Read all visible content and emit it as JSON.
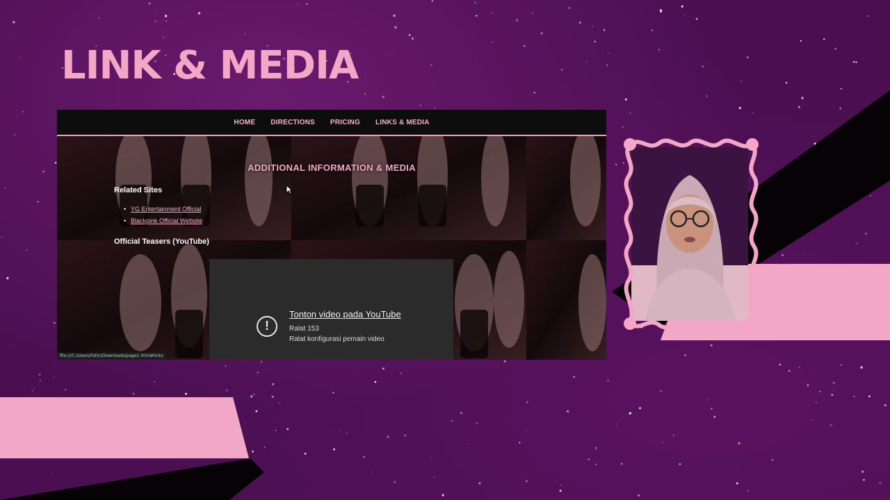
{
  "slide": {
    "title": "LINK & MEDIA",
    "colors": {
      "pink": "#f4a6c6",
      "purple": "#4a0f50",
      "black": "#050205"
    }
  },
  "browser": {
    "nav": [
      "HOME",
      "DIRECTIONS",
      "PRICING",
      "LINKS & MEDIA"
    ],
    "section_heading": "ADDITIONAL INFORMATION & MEDIA",
    "related_heading": "Related Sites",
    "related_links": [
      "YG Entertainment Official",
      "Blackpink Official Website"
    ],
    "teasers_heading": "Official Teasers (YouTube)",
    "youtube": {
      "icon": "alert-circle-icon",
      "link": "Tonton video pada YouTube",
      "error_code": "Ralat 153",
      "error_message": "Ralat konfigurasi pemain video"
    },
    "status_url": "file:///C:/Users/Fatin/Downloads/page1.html#links"
  },
  "webcam": {
    "frame": "wavy-pink-frame"
  }
}
